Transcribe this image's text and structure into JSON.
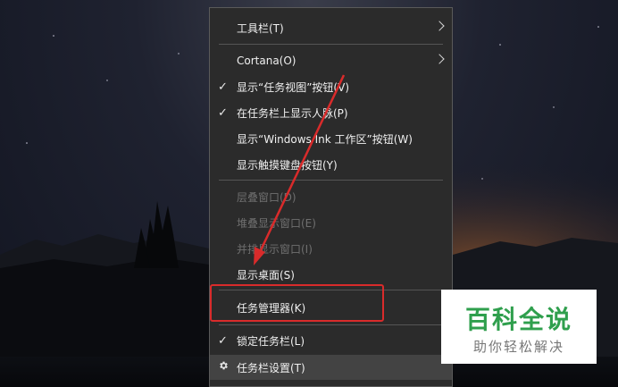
{
  "context_menu": {
    "items": [
      {
        "label": "工具栏(T)",
        "checked": false,
        "disabled": false,
        "submenu": true
      },
      {
        "label": "Cortana(O)",
        "checked": false,
        "disabled": false,
        "submenu": true
      },
      {
        "label": "显示“任务视图”按钮(V)",
        "checked": true,
        "disabled": false,
        "submenu": false
      },
      {
        "label": "在任务栏上显示人脉(P)",
        "checked": true,
        "disabled": false,
        "submenu": false
      },
      {
        "label": "显示“Windows Ink 工作区”按钮(W)",
        "checked": false,
        "disabled": false,
        "submenu": false
      },
      {
        "label": "显示触摸键盘按钮(Y)",
        "checked": false,
        "disabled": false,
        "submenu": false
      },
      {
        "label": "层叠窗口(D)",
        "checked": false,
        "disabled": true,
        "submenu": false
      },
      {
        "label": "堆叠显示窗口(E)",
        "checked": false,
        "disabled": true,
        "submenu": false
      },
      {
        "label": "并排显示窗口(I)",
        "checked": false,
        "disabled": true,
        "submenu": false
      },
      {
        "label": "显示桌面(S)",
        "checked": false,
        "disabled": false,
        "submenu": false
      },
      {
        "label": "任务管理器(K)",
        "checked": false,
        "disabled": false,
        "submenu": false
      },
      {
        "label": "锁定任务栏(L)",
        "checked": true,
        "disabled": false,
        "submenu": false
      },
      {
        "label": "任务栏设置(T)",
        "checked": false,
        "disabled": false,
        "submenu": false,
        "icon": "gear-icon"
      }
    ],
    "check_glyph": "✓"
  },
  "annotation": {
    "highlight_color": "#d92b2b",
    "arrow_color": "#d92b2b"
  },
  "watermark": {
    "title": "百科全说",
    "subtitle": "助你轻松解决",
    "title_color": "#2f9f4d"
  }
}
